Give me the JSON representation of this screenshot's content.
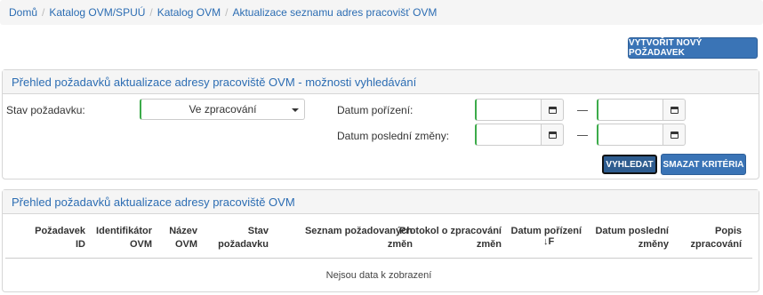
{
  "breadcrumb": {
    "items": [
      "Domů",
      "Katalog OVM/SPUÚ",
      "Katalog OVM"
    ],
    "current": "Aktualizace seznamu adres pracovišť OVM"
  },
  "actions": {
    "new_request": "VYTVOŘIT NOVÝ POŽADAVEK"
  },
  "search_panel": {
    "title": "Přehled požadavků aktualizace adresy pracoviště OVM - možnosti vyhledávání",
    "status_label": "Stav požadavku:",
    "status_value": "Ve zpracování",
    "date_acquired_label": "Datum pořízení:",
    "date_changed_label": "Datum poslední změny:",
    "date_acquired_from": "",
    "date_acquired_to": "",
    "date_changed_from": "",
    "date_changed_to": "",
    "search_button": "VYHLEDAT",
    "clear_button": "SMAZAT KRITÉRIA"
  },
  "results_panel": {
    "title": "Přehled požadavků aktualizace adresy pracoviště OVM",
    "columns": [
      [
        "Požadavek",
        "ID"
      ],
      [
        "Identifikátor",
        "OVM"
      ],
      [
        "Název",
        "OVM"
      ],
      [
        "Stav",
        "požadavku"
      ],
      [
        "Seznam požadovaných",
        "změn"
      ],
      [
        "Protokol o zpracování",
        "změn"
      ],
      [
        "Datum pořízení",
        ""
      ],
      [
        "Datum poslední",
        "změny"
      ],
      [
        "Popis",
        "zpracování"
      ]
    ],
    "sort_indicator": "↓F",
    "empty_message": "Nejsou data k zobrazení"
  },
  "colors": {
    "accent": "#3a74b6",
    "link": "#2c6db3",
    "valid_border": "#3cab4a"
  }
}
